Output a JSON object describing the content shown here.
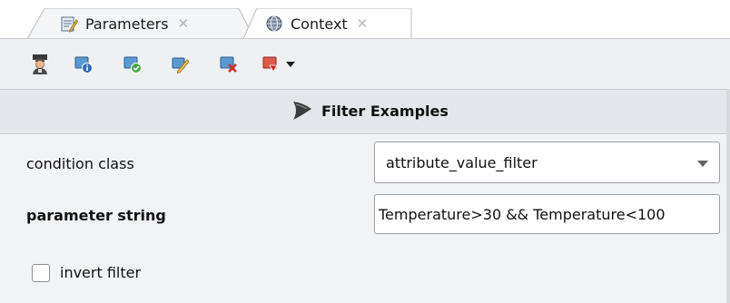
{
  "tabs": [
    {
      "label": "Parameters",
      "icon": "parameters-icon",
      "active": true
    },
    {
      "label": "Context",
      "icon": "globe-icon",
      "active": false
    }
  ],
  "toolbar": {
    "buttons": [
      {
        "name": "expert-mode-icon"
      },
      {
        "name": "info-icon"
      },
      {
        "name": "validate-icon"
      },
      {
        "name": "edit-icon"
      },
      {
        "name": "remove-icon"
      },
      {
        "name": "breakpoint-menu-icon"
      }
    ]
  },
  "operator": {
    "title": "Filter Examples",
    "icon": "filter-icon"
  },
  "params": {
    "condition_class": {
      "label": "condition class",
      "value": "attribute_value_filter"
    },
    "parameter_string": {
      "label": "parameter string",
      "value": "Temperature>30 && Temperature<100"
    },
    "invert_filter": {
      "label": "invert filter",
      "checked": false
    }
  },
  "colors": {
    "toolbar_bg": "#eef0f2",
    "header_bg": "#e3e6ea",
    "panel_bg": "#f2f3f5"
  }
}
